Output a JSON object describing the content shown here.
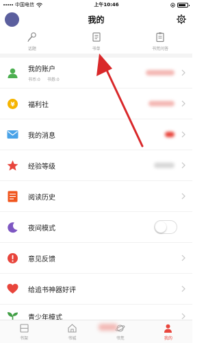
{
  "status_bar": {
    "carrier": "中国电信",
    "time": "上午10:46",
    "battery_level": 0.85
  },
  "header": {
    "title": "我的"
  },
  "quick_actions": [
    {
      "label": "话题",
      "icon": "microphone-icon"
    },
    {
      "label": "书单",
      "icon": "booklist-icon"
    },
    {
      "label": "书荒问答",
      "icon": "clipboard-icon"
    }
  ],
  "menu": {
    "account": {
      "label": "我的账户",
      "coins_label": "书币:0",
      "vouchers_label": "书券:0",
      "icon": "user-icon"
    },
    "welfare": {
      "label": "福利社",
      "icon": "coin-icon"
    },
    "messages": {
      "label": "我的消息",
      "icon": "mail-icon"
    },
    "level": {
      "label": "经验等级",
      "icon": "star-icon"
    },
    "history": {
      "label": "阅读历史",
      "icon": "history-icon"
    },
    "night_mode": {
      "label": "夜间模式",
      "icon": "moon-icon",
      "enabled": false
    },
    "feedback": {
      "label": "意见反馈",
      "icon": "alert-icon"
    },
    "rate": {
      "label": "给追书神器好评",
      "icon": "heart-icon"
    },
    "teen_mode": {
      "label": "青少年模式",
      "icon": "sprout-icon"
    }
  },
  "tabs": [
    {
      "label": "书架",
      "icon": "bookshelf-icon",
      "active": false
    },
    {
      "label": "书城",
      "icon": "home-icon",
      "active": false
    },
    {
      "label": "书荒",
      "icon": "planet-icon",
      "active": false
    },
    {
      "label": "我的",
      "icon": "profile-icon",
      "active": true
    }
  ],
  "colors": {
    "accent": "#e8453c",
    "account_icon": "#4caf50",
    "welfare_icon": "#f5b400",
    "messages_icon": "#4aa3e8",
    "level_icon": "#e8453c",
    "history_icon": "#f0561e",
    "night_icon": "#7e57c2",
    "feedback_icon": "#e8453c",
    "rate_icon": "#e8453c",
    "teen_icon": "#43a047",
    "annotation_arrow": "#d9282a"
  }
}
